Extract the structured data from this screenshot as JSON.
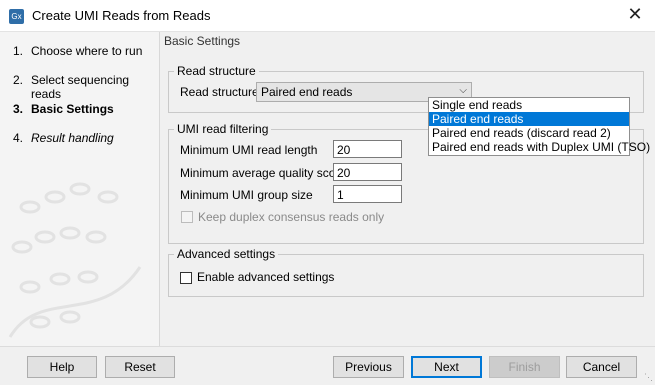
{
  "window": {
    "icon_text": "Gx",
    "title": "Create UMI Reads from Reads",
    "close_glyph": "✕"
  },
  "steps": [
    {
      "num": "1.",
      "label": "Choose where to run"
    },
    {
      "num": "2.",
      "label": "Select sequencing reads"
    },
    {
      "num": "3.",
      "label": "Basic Settings"
    },
    {
      "num": "4.",
      "label": "Result handling"
    }
  ],
  "main": {
    "header": "Basic Settings",
    "read_structure": {
      "group_title": "Read structure",
      "label": "Read structure",
      "value": "Paired end reads",
      "options": [
        "Single end reads",
        "Paired end reads",
        "Paired end reads (discard read 2)",
        "Paired end reads with Duplex UMI (TSO)"
      ],
      "selected_index": 1
    },
    "umi_filtering": {
      "group_title": "UMI read filtering",
      "min_umi_read_length_label": "Minimum UMI read length",
      "min_umi_read_length": "20",
      "min_avg_quality_label": "Minimum average quality score",
      "min_avg_quality": "20",
      "min_group_size_label": "Minimum UMI group size",
      "min_group_size": "1",
      "keep_duplex_label": "Keep duplex consensus reads only"
    },
    "advanced": {
      "group_title": "Advanced settings",
      "enable_label": "Enable advanced settings"
    }
  },
  "footer": {
    "help": "Help",
    "reset": "Reset",
    "previous": "Previous",
    "next": "Next",
    "finish": "Finish",
    "cancel": "Cancel"
  }
}
